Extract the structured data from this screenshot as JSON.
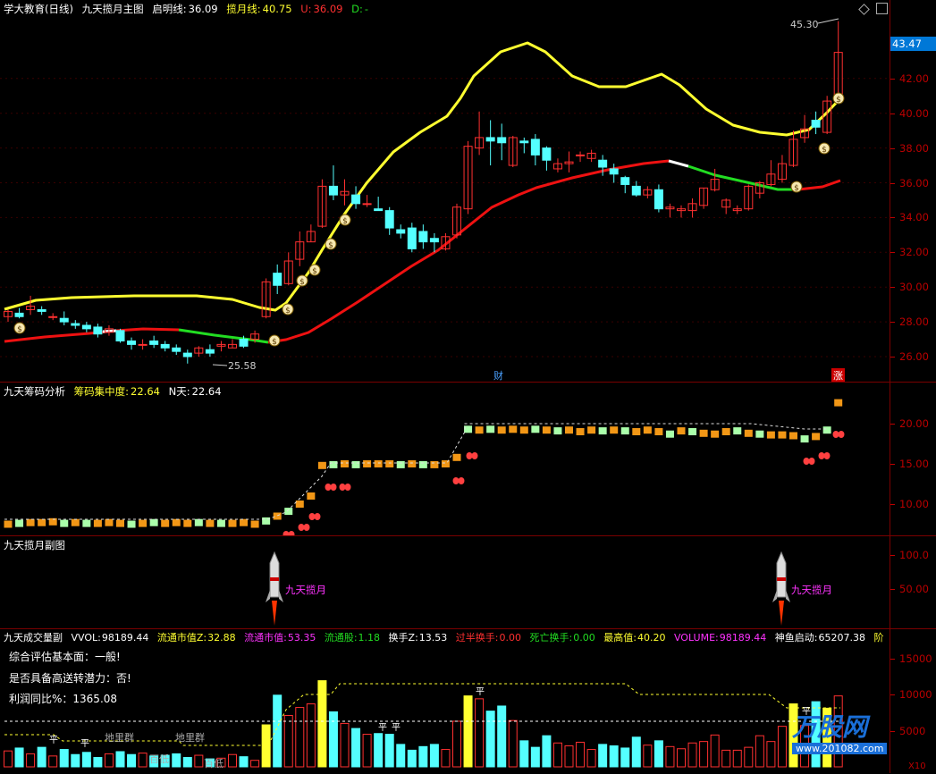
{
  "main": {
    "title": "学大教育(日线)",
    "indicator": "九天揽月主图",
    "qiming_label": "启明线:",
    "qiming_value": "36.09",
    "lanyue_label": "揽月线:",
    "lanyue_value": "40.75",
    "u_label": "U:",
    "u_value": "36.09",
    "d_label": "D:",
    "d_value": "-",
    "price_ticks": [
      "42.00",
      "40.00",
      "38.00",
      "36.00",
      "34.00",
      "32.00",
      "30.00",
      "28.00",
      "26.00"
    ],
    "current_price": "43.47",
    "high_marker": "45.30",
    "low_marker": "25.58",
    "marker_cai": "财",
    "marker_zhang": "涨",
    "colors": {
      "up": "#ff3030",
      "down": "#54ffff",
      "yellow": "#ffff30",
      "red": "#ee1111",
      "green": "#22dd22",
      "white": "#ffffff",
      "orange": "#f29716",
      "lightgreen": "#aaffaa"
    }
  },
  "chip": {
    "title": "九天筹码分析",
    "conc_label": "筹码集中度:",
    "conc_value": "22.64",
    "n_label": "N天:",
    "n_value": "22.64",
    "ticks": [
      "20.00",
      "15.00",
      "10.00"
    ]
  },
  "sub": {
    "title": "九天揽月副图",
    "ticks": [
      "100.0",
      "50.00"
    ],
    "signal_label": "九天揽月"
  },
  "vol": {
    "title": "九天成交量副",
    "vol_label": "VVOL:",
    "vol_value": "98189.44",
    "ltszz_label": "流通市值Z:",
    "ltszz_value": "32.88",
    "ltsz_label": "流通市值:",
    "ltsz_value": "53.35",
    "ltg_label": "流通股:",
    "ltg_value": "1.18",
    "hsz_label": "换手Z:",
    "hsz_value": "13.53",
    "gbhs_label": "过半换手:",
    "gbhs_value": "0.00",
    "swhs_label": "死亡换手:",
    "swhs_value": "0.00",
    "zgz_label": "最高值:",
    "zgz_value": "40.20",
    "volume_label": "VOLUME:",
    "volume_value": "98189.44",
    "syqd_label": "神鱼启动:",
    "syqd_value": "65207.38",
    "tail": "阶",
    "line1": "综合评估基本面：一般!",
    "line2": "是否具备高送转潜力：否!",
    "line3": "利润同比%：1365.08",
    "ticks": [
      "15000",
      "10000",
      "5000"
    ],
    "unit": "X10",
    "labels": {
      "dili": "地里群",
      "baili": "百低",
      "ping": "平"
    },
    "watermark": "万股网",
    "watermark_url": "www.201082.com"
  },
  "candles": [
    [
      28.3,
      28.6,
      28.0,
      28.7
    ],
    [
      28.5,
      28.3,
      28.2,
      28.8
    ],
    [
      28.7,
      28.9,
      28.4,
      29.5
    ],
    [
      28.7,
      28.6,
      28.4,
      28.9
    ],
    [
      28.3,
      28.3,
      28.1,
      28.5
    ],
    [
      28.2,
      28.0,
      27.8,
      28.6
    ],
    [
      27.9,
      27.8,
      27.6,
      28.1
    ],
    [
      27.8,
      27.6,
      27.4,
      28.0
    ],
    [
      27.7,
      27.3,
      27.1,
      27.9
    ],
    [
      27.4,
      27.6,
      27.2,
      27.8
    ],
    [
      27.5,
      26.9,
      26.8,
      27.6
    ],
    [
      26.9,
      26.7,
      26.4,
      27.1
    ],
    [
      26.7,
      26.7,
      26.4,
      27.0
    ],
    [
      26.9,
      26.7,
      26.5,
      27.2
    ],
    [
      26.7,
      26.5,
      26.3,
      26.9
    ],
    [
      26.5,
      26.3,
      26.1,
      26.7
    ],
    [
      26.2,
      26.0,
      25.6,
      26.4
    ],
    [
      26.2,
      26.5,
      26.0,
      26.6
    ],
    [
      26.4,
      26.2,
      26.0,
      26.7
    ],
    [
      26.6,
      26.7,
      26.3,
      26.9
    ],
    [
      26.5,
      26.7,
      26.5,
      27.0
    ],
    [
      27.0,
      26.6,
      26.5,
      27.2
    ],
    [
      27.0,
      27.3,
      26.8,
      27.5
    ],
    [
      28.3,
      30.3,
      28.2,
      30.5
    ],
    [
      30.8,
      30.1,
      29.6,
      31.3
    ],
    [
      30.2,
      31.5,
      30.1,
      32.0
    ],
    [
      31.6,
      32.6,
      31.2,
      33.2
    ],
    [
      32.6,
      33.2,
      32.6,
      33.6
    ],
    [
      33.5,
      35.8,
      33.4,
      36.2
    ],
    [
      35.8,
      35.3,
      35.0,
      37.0
    ],
    [
      35.3,
      35.5,
      34.7,
      36.2
    ],
    [
      35.3,
      34.8,
      34.5,
      35.8
    ],
    [
      34.8,
      34.8,
      34.6,
      35.3
    ],
    [
      34.5,
      34.4,
      34.4,
      35.2
    ],
    [
      34.4,
      33.4,
      33.0,
      34.6
    ],
    [
      33.3,
      33.1,
      32.8,
      33.6
    ],
    [
      33.4,
      32.2,
      32.0,
      33.7
    ],
    [
      33.2,
      32.6,
      32.2,
      33.6
    ],
    [
      32.8,
      32.6,
      32.0,
      33.1
    ],
    [
      32.2,
      32.9,
      32.1,
      33.1
    ],
    [
      33.0,
      34.6,
      32.8,
      34.8
    ],
    [
      34.5,
      38.1,
      34.2,
      38.4
    ],
    [
      38.0,
      38.6,
      37.6,
      40.1
    ],
    [
      38.6,
      38.4,
      37.0,
      39.6
    ],
    [
      38.6,
      38.3,
      37.3,
      39.4
    ],
    [
      37.0,
      38.6,
      36.9,
      38.7
    ],
    [
      38.4,
      38.3,
      37.7,
      38.6
    ],
    [
      38.5,
      37.6,
      37.0,
      38.8
    ],
    [
      38.0,
      37.3,
      36.7,
      38.1
    ],
    [
      36.8,
      37.1,
      36.6,
      37.4
    ],
    [
      37.1,
      37.2,
      36.6,
      37.8
    ],
    [
      37.6,
      37.6,
      37.2,
      37.8
    ],
    [
      37.4,
      37.7,
      37.2,
      37.9
    ],
    [
      37.3,
      36.9,
      36.4,
      37.6
    ],
    [
      36.8,
      36.5,
      36.0,
      37.1
    ],
    [
      36.3,
      35.9,
      35.4,
      36.4
    ],
    [
      35.8,
      35.3,
      35.2,
      36.1
    ],
    [
      35.3,
      35.6,
      35.1,
      35.8
    ],
    [
      35.6,
      34.5,
      34.3,
      35.9
    ],
    [
      34.5,
      34.6,
      34.0,
      34.8
    ],
    [
      34.4,
      34.5,
      34.0,
      34.7
    ],
    [
      34.4,
      34.8,
      34.0,
      35.1
    ],
    [
      34.7,
      35.7,
      34.5,
      35.7
    ],
    [
      35.6,
      36.2,
      35.5,
      36.8
    ],
    [
      34.6,
      35.0,
      34.2,
      35.1
    ],
    [
      34.4,
      34.5,
      34.2,
      34.7
    ],
    [
      34.5,
      35.8,
      34.4,
      35.9
    ],
    [
      35.4,
      36.0,
      35.1,
      36.1
    ],
    [
      35.9,
      36.5,
      35.8,
      37.3
    ],
    [
      36.2,
      37.1,
      36.0,
      37.6
    ],
    [
      37.0,
      38.5,
      36.9,
      39.0
    ],
    [
      38.6,
      39.1,
      38.3,
      39.9
    ],
    [
      39.6,
      39.2,
      38.8,
      40.1
    ],
    [
      38.9,
      40.7,
      38.8,
      41.0
    ],
    [
      41.0,
      43.5,
      40.6,
      45.3
    ]
  ]
}
